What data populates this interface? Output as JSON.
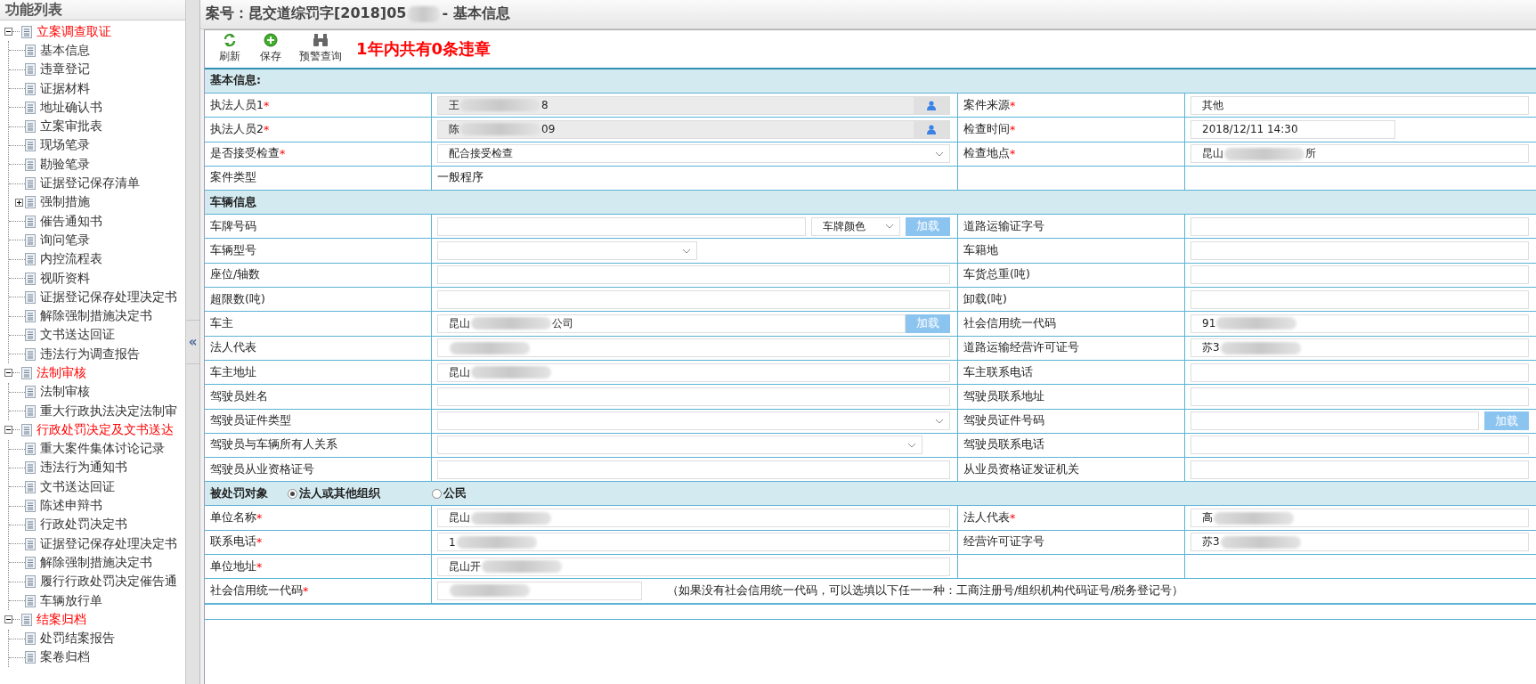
{
  "sidebar": {
    "title": "功能列表",
    "tree": [
      {
        "label": "立案调查取证",
        "expanded": true,
        "children": [
          {
            "label": "基本信息"
          },
          {
            "label": "违章登记"
          },
          {
            "label": "证据材料"
          },
          {
            "label": "地址确认书"
          },
          {
            "label": "立案审批表"
          },
          {
            "label": "现场笔录"
          },
          {
            "label": "勘验笔录"
          },
          {
            "label": "证据登记保存清单"
          },
          {
            "label": "强制措施",
            "expanded": false
          },
          {
            "label": "催告通知书"
          },
          {
            "label": "询问笔录"
          },
          {
            "label": "内控流程表"
          },
          {
            "label": "视听资料"
          },
          {
            "label": "证据登记保存处理决定书"
          },
          {
            "label": "解除强制措施决定书"
          },
          {
            "label": "文书送达回证"
          },
          {
            "label": "违法行为调查报告"
          }
        ]
      },
      {
        "label": "法制审核",
        "expanded": true,
        "children": [
          {
            "label": "法制审核"
          },
          {
            "label": "重大行政执法决定法制审"
          }
        ]
      },
      {
        "label": "行政处罚决定及文书送达",
        "expanded": true,
        "children": [
          {
            "label": "重大案件集体讨论记录"
          },
          {
            "label": "违法行为通知书"
          },
          {
            "label": "文书送达回证"
          },
          {
            "label": "陈述申辩书"
          },
          {
            "label": "行政处罚决定书"
          },
          {
            "label": "证据登记保存处理决定书"
          },
          {
            "label": "解除强制措施决定书"
          },
          {
            "label": "履行行政处罚决定催告通"
          },
          {
            "label": "车辆放行单"
          }
        ]
      },
      {
        "label": "结案归档",
        "expanded": true,
        "children": [
          {
            "label": "处罚结案报告"
          },
          {
            "label": "案卷归档"
          }
        ]
      }
    ],
    "collapse": "«"
  },
  "header": {
    "title_start": "案号：昆交道综罚字[2018]05",
    "redacted": true,
    "title_end": "- 基本信息"
  },
  "toolbar": {
    "buttons": [
      {
        "kind": "refresh",
        "label": "刷新"
      },
      {
        "kind": "add",
        "label": "保存"
      },
      {
        "kind": "binoculars",
        "label": "预警查询"
      }
    ],
    "notice": "1年内共有0条违章"
  },
  "sections": [
    {
      "title": "基本信息:",
      "rows": [
        [
          {
            "label": "执法人员1",
            "required_mark": "*",
            "controls": [
              {
                "kind": "person-input",
                "value": "王",
                "redacted": true,
                "value_end": "8"
              }
            ]
          },
          {
            "label": "案件来源",
            "required_mark": "*",
            "controls": [
              {
                "kind": "input",
                "value": "其他"
              }
            ]
          }
        ],
        [
          {
            "label": "执法人员2",
            "required_mark": "*",
            "controls": [
              {
                "kind": "person-input",
                "value": "陈",
                "redacted": true,
                "value_end": "09"
              }
            ]
          },
          {
            "label": "检查时间",
            "required_mark": "*",
            "controls": [
              {
                "kind": "short-input",
                "value": "2018/12/11 14:30"
              }
            ]
          }
        ],
        [
          {
            "label": "是否接受检查",
            "required_mark": "*",
            "controls": [
              {
                "kind": "select",
                "value": "配合接受检查"
              }
            ]
          },
          {
            "label": "检查地点",
            "required_mark": "*",
            "controls": [
              {
                "kind": "input",
                "value": "昆山",
                "redacted": true,
                "value_end": "所"
              }
            ]
          }
        ],
        [
          {
            "label": "案件类型",
            "controls": [
              {
                "kind": "text",
                "value": "一般程序"
              }
            ]
          },
          {}
        ]
      ]
    },
    {
      "title": "车辆信息",
      "rows": [
        [
          {
            "label": "车牌号码",
            "controls": [
              {
                "kind": "input"
              },
              {
                "kind": "small-select",
                "value": "车牌颜色"
              },
              {
                "kind": "button",
                "value": "加载"
              }
            ]
          },
          {
            "label": "道路运输证字号",
            "controls": [
              {
                "kind": "input"
              }
            ]
          }
        ],
        [
          {
            "label": "车辆型号",
            "controls": [
              {
                "kind": "half-select"
              }
            ]
          },
          {
            "label": "车籍地",
            "controls": [
              {
                "kind": "input"
              }
            ]
          }
        ],
        [
          {
            "label": "座位/轴数",
            "controls": [
              {
                "kind": "input"
              }
            ]
          },
          {
            "label": "车货总重(吨)",
            "controls": [
              {
                "kind": "input"
              }
            ]
          }
        ],
        [
          {
            "label": "超限数(吨)",
            "controls": [
              {
                "kind": "input"
              }
            ]
          },
          {
            "label": "卸载(吨)",
            "controls": [
              {
                "kind": "input"
              }
            ]
          }
        ],
        [
          {
            "label": "车主",
            "controls": [
              {
                "kind": "input",
                "value": "昆山",
                "redacted": true,
                "value_end": "公司"
              },
              {
                "kind": "attached-button",
                "value": "加载"
              }
            ]
          },
          {
            "label": "社会信用统一代码",
            "controls": [
              {
                "kind": "input",
                "value": "91",
                "redacted": true
              }
            ]
          }
        ],
        [
          {
            "label": "法人代表",
            "controls": [
              {
                "kind": "input",
                "redacted": true
              }
            ]
          },
          {
            "label": "道路运输经营许可证号",
            "controls": [
              {
                "kind": "input",
                "value": "苏3",
                "redacted": true
              }
            ]
          }
        ],
        [
          {
            "label": "车主地址",
            "controls": [
              {
                "kind": "input",
                "value": "昆山",
                "redacted": true
              }
            ]
          },
          {
            "label": "车主联系电话",
            "controls": [
              {
                "kind": "input"
              }
            ]
          }
        ],
        [
          {
            "label": "驾驶员姓名",
            "controls": [
              {
                "kind": "input"
              }
            ]
          },
          {
            "label": "驾驶员联系地址",
            "controls": [
              {
                "kind": "input"
              }
            ]
          }
        ],
        [
          {
            "label": "驾驶员证件类型",
            "controls": [
              {
                "kind": "select"
              }
            ]
          },
          {
            "label": "驾驶员证件号码",
            "controls": [
              {
                "kind": "input"
              },
              {
                "kind": "button",
                "value": "加载"
              }
            ]
          }
        ],
        [
          {
            "label": "驾驶员与车辆所有人关系",
            "controls": [
              {
                "kind": "short-select"
              }
            ]
          },
          {
            "label": "驾驶员联系电话",
            "controls": [
              {
                "kind": "input"
              }
            ]
          }
        ],
        [
          {
            "label": "驾驶员从业资格证号",
            "controls": [
              {
                "kind": "input"
              }
            ]
          },
          {
            "label": "从业员资格证发证机关",
            "controls": [
              {
                "kind": "input"
              }
            ]
          }
        ]
      ]
    },
    {
      "title": "被处罚对象",
      "radios": [
        {
          "label": "法人或其他组织",
          "selected": true
        },
        {
          "label": "公民",
          "selected": false
        }
      ],
      "rows": [
        [
          {
            "label": "单位名称",
            "required_mark": "*",
            "controls": [
              {
                "kind": "input",
                "value": "昆山",
                "redacted": true
              }
            ]
          },
          {
            "label": "法人代表",
            "required_mark": "*",
            "controls": [
              {
                "kind": "input",
                "value": "高",
                "redacted": true
              }
            ]
          }
        ],
        [
          {
            "label": "联系电话",
            "required_mark": "*",
            "controls": [
              {
                "kind": "input",
                "value": "1",
                "redacted": true
              }
            ]
          },
          {
            "label": "经营许可证字号",
            "controls": [
              {
                "kind": "input",
                "value": "苏3",
                "redacted": true
              }
            ]
          }
        ],
        [
          {
            "label": "单位地址",
            "required_mark": "*",
            "controls": [
              {
                "kind": "input",
                "value": "昆山开",
                "redacted": true
              }
            ]
          },
          {}
        ],
        [
          {
            "label": "社会信用统一代码",
            "required_mark": "*",
            "wide": true,
            "controls": [
              {
                "kind": "short-input",
                "redacted": true
              },
              {
                "kind": "note",
                "value": "（如果没有社会信用统一代码，可以选填以下任一一种：工商注册号/组织机构代码证号/税务登记号）"
              }
            ]
          }
        ]
      ]
    }
  ]
}
